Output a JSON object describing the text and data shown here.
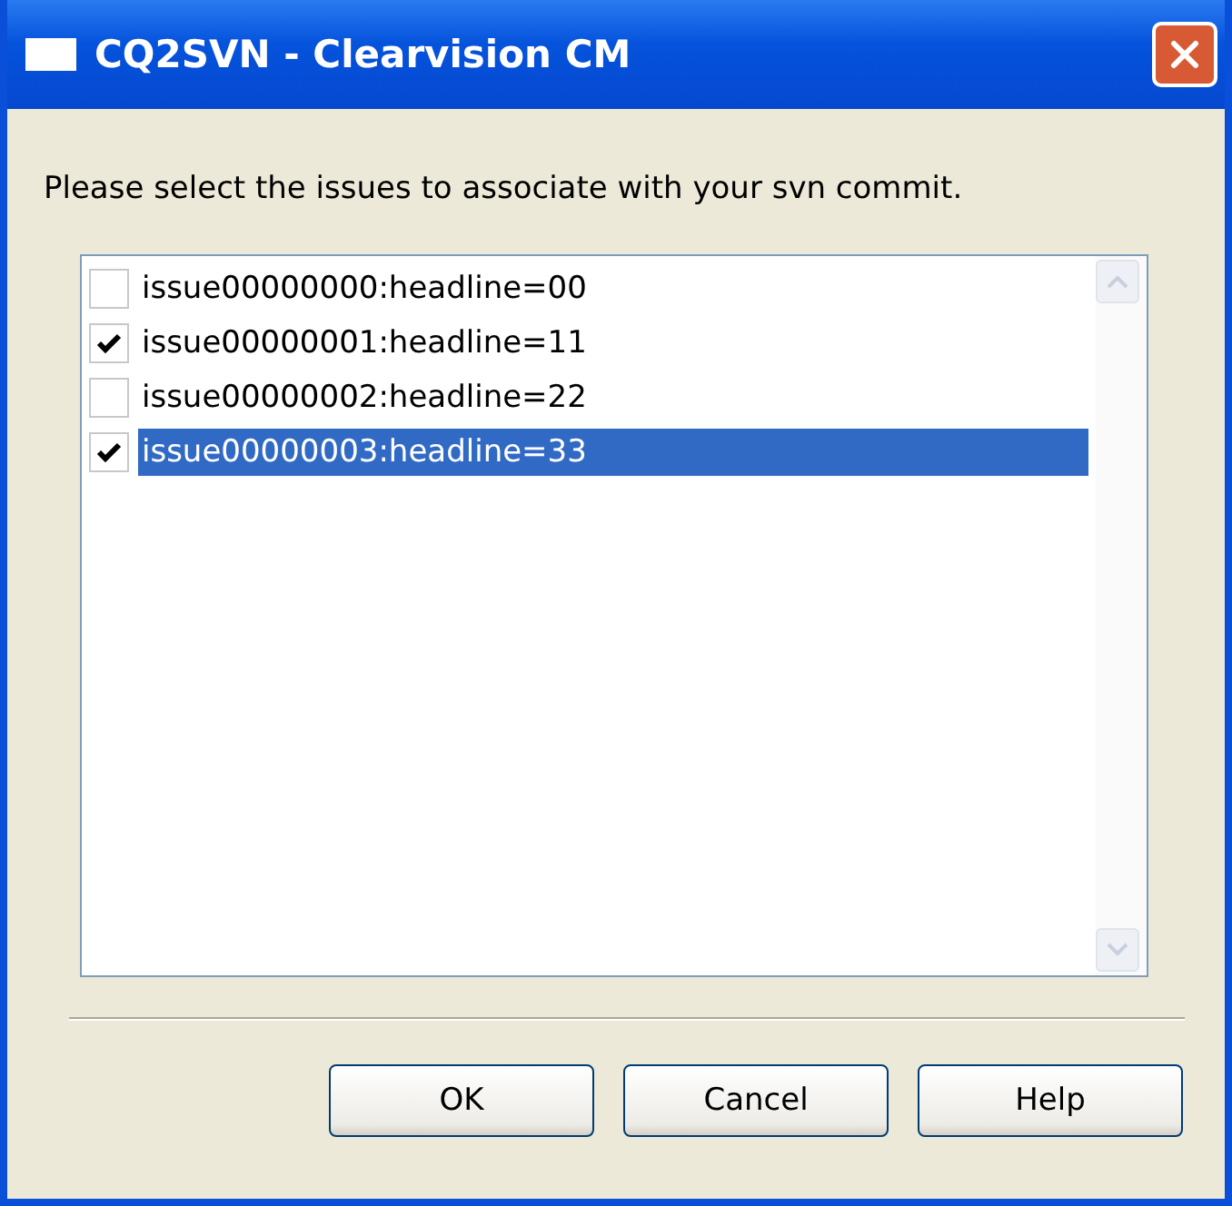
{
  "window": {
    "title": "CQ2SVN - Clearvision CM"
  },
  "instruction": "Please select the issues to associate with your svn commit.",
  "issues": [
    {
      "label": "issue00000000:headline=00",
      "checked": false,
      "selected": false
    },
    {
      "label": "issue00000001:headline=11",
      "checked": true,
      "selected": false
    },
    {
      "label": "issue00000002:headline=22",
      "checked": false,
      "selected": false
    },
    {
      "label": "issue00000003:headline=33",
      "checked": true,
      "selected": true
    }
  ],
  "buttons": [
    "OK",
    "Cancel",
    "Help"
  ]
}
